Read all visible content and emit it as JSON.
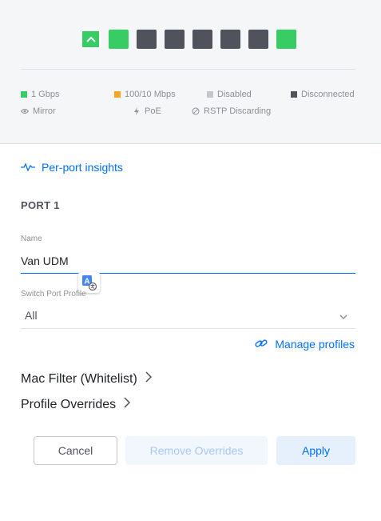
{
  "ports": [
    {
      "status": "1g",
      "selected": true
    },
    {
      "status": "1g",
      "selected": false
    },
    {
      "status": "disconnected",
      "selected": false
    },
    {
      "status": "disconnected",
      "selected": false
    },
    {
      "status": "disconnected",
      "selected": false
    },
    {
      "status": "disconnected",
      "selected": false
    },
    {
      "status": "disconnected",
      "selected": false
    },
    {
      "status": "1g",
      "selected": false
    }
  ],
  "legend": {
    "gbps": "1 Gbps",
    "mbps": "100/10 Mbps",
    "disabled": "Disabled",
    "disconnected": "Disconnected",
    "mirror": "Mirror",
    "poe": "PoE",
    "rstp": "RSTP Discarding"
  },
  "colors": {
    "gbps": "#38cc65",
    "mbps": "#f5a623",
    "disabled": "#c5c7cc",
    "disconnected": "#50535c",
    "accent": "#006fff"
  },
  "insights_link": "Per-port insights",
  "port_title": "PORT 1",
  "name_field": {
    "label": "Name",
    "value": "Van UDM"
  },
  "profile_field": {
    "label": "Switch Port Profile",
    "value": "All"
  },
  "manage_profiles": "Manage profiles",
  "mac_filter": "Mac Filter (Whitelist)",
  "profile_overrides": "Profile Overrides",
  "buttons": {
    "cancel": "Cancel",
    "remove_overrides": "Remove Overrides",
    "apply": "Apply"
  }
}
